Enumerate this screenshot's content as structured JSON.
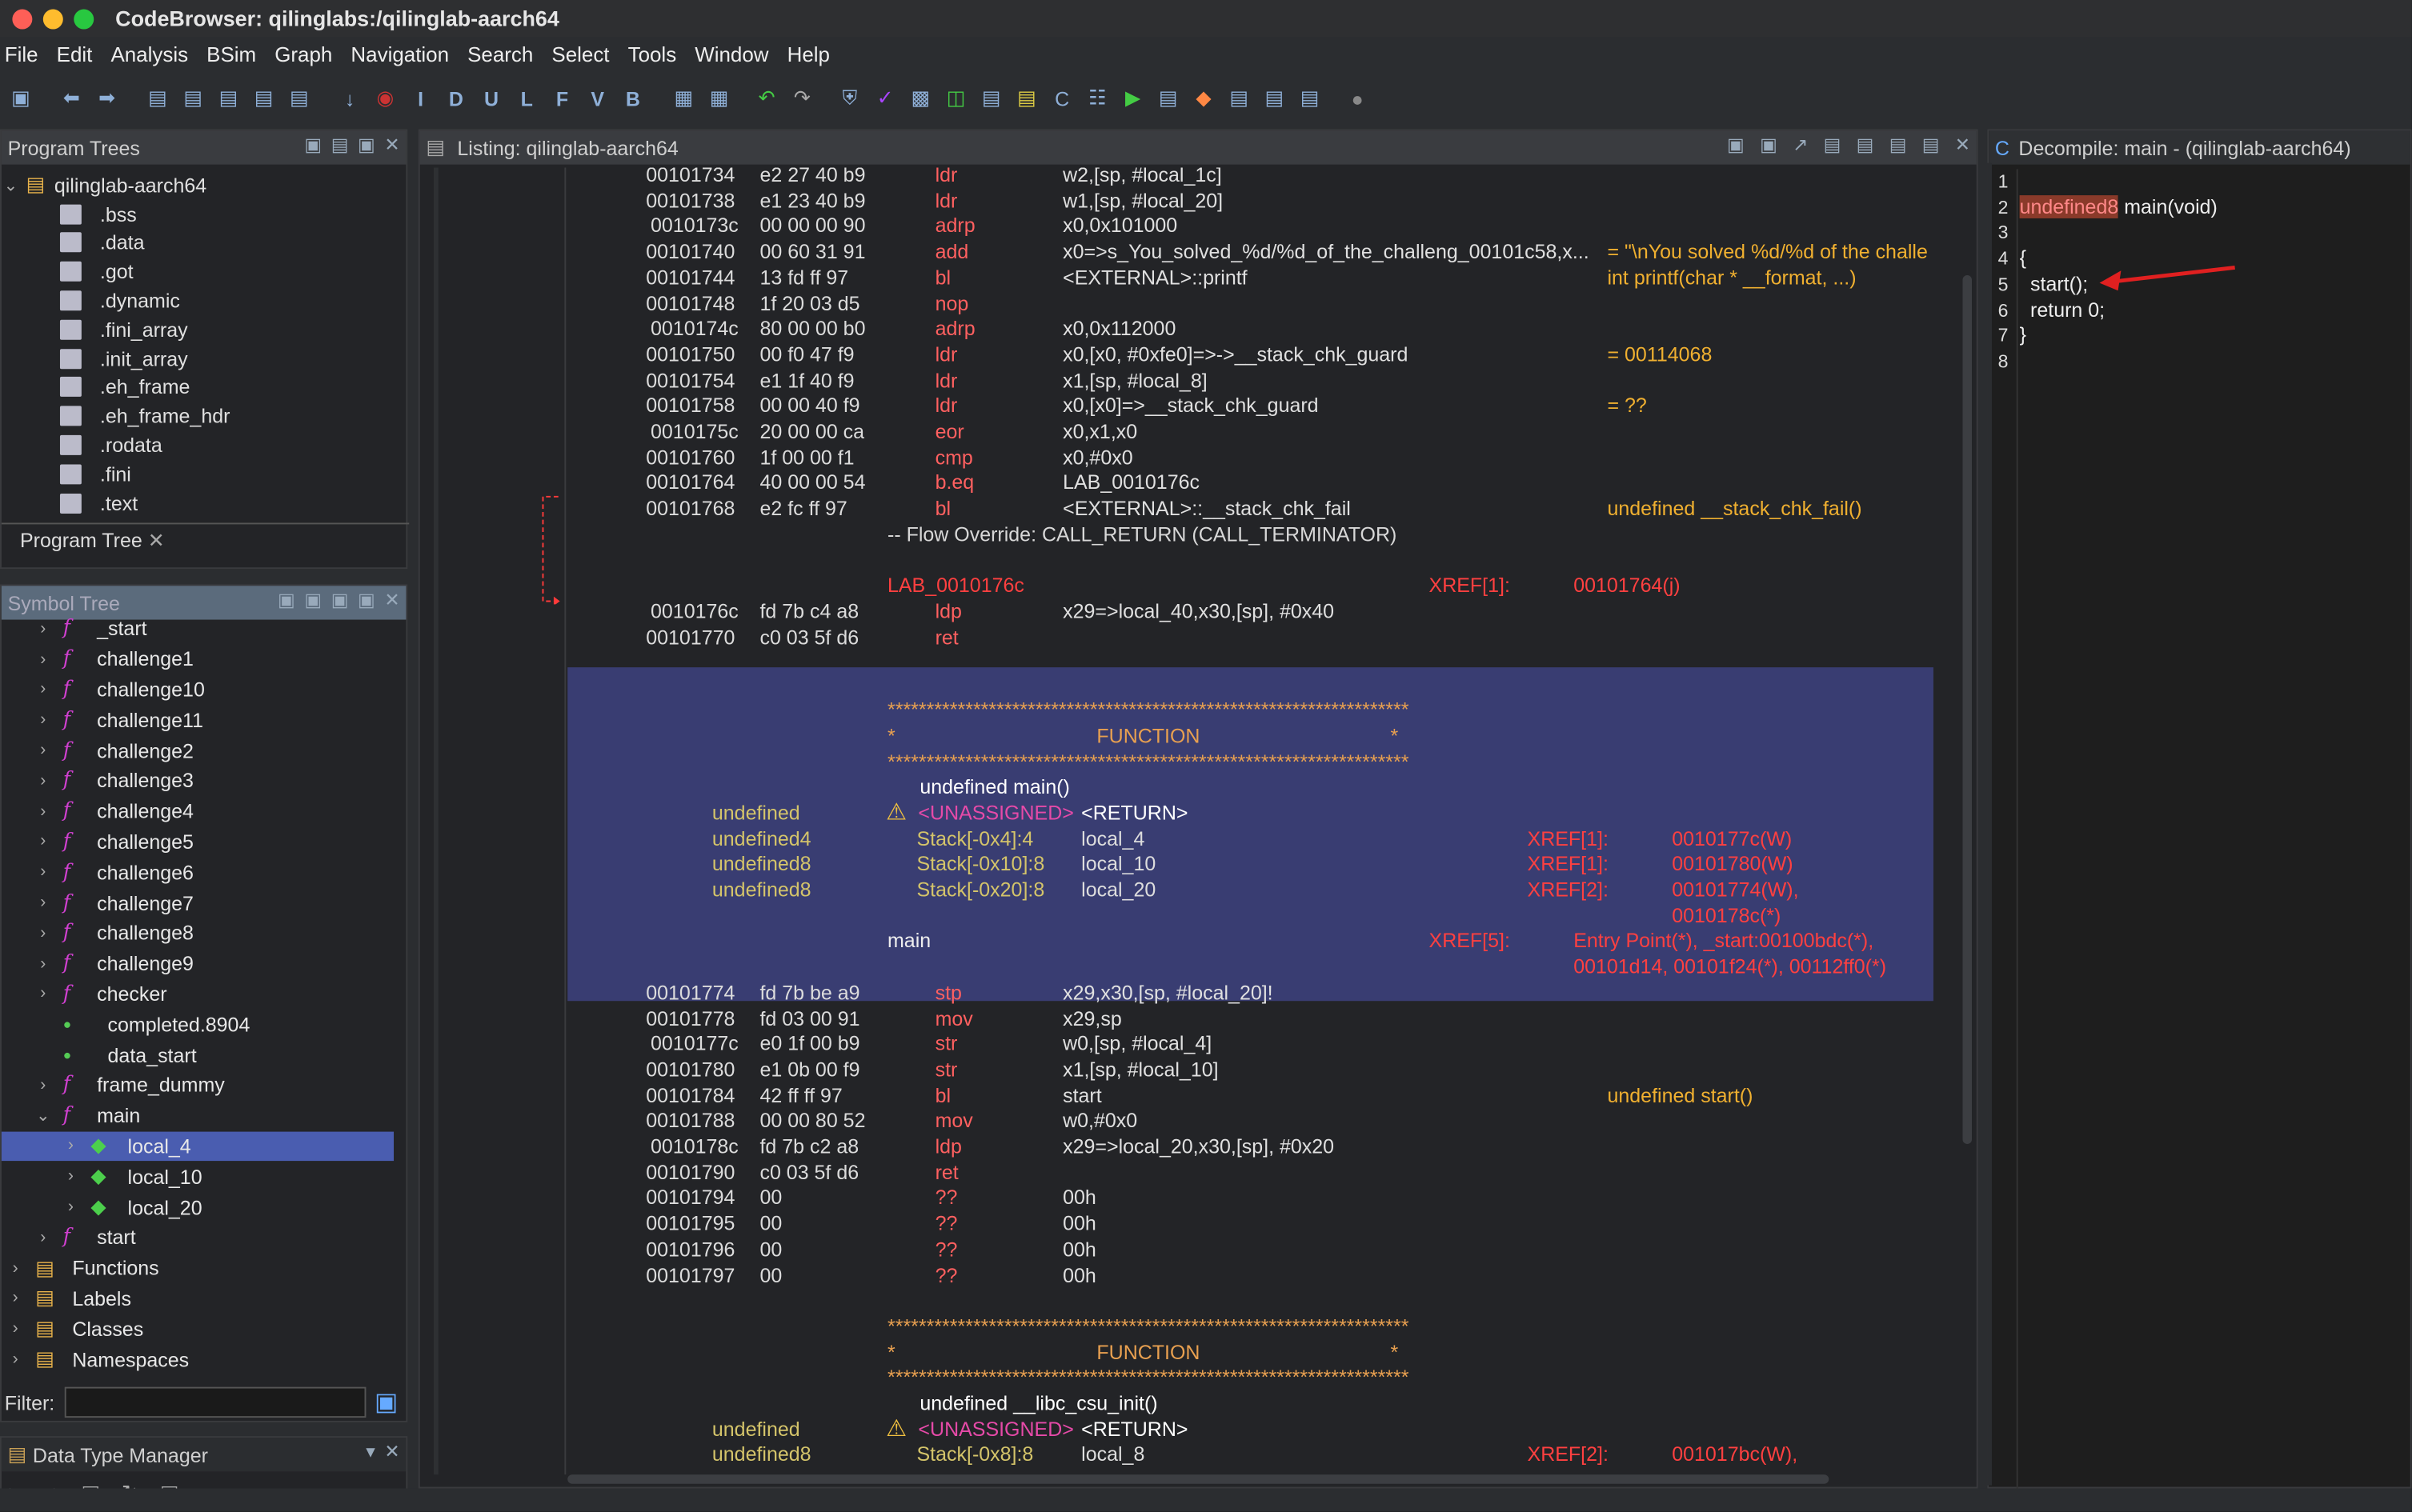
{
  "window": {
    "title": "CodeBrowser: qilinglabs:/qilinglab-aarch64"
  },
  "menu": [
    "File",
    "Edit",
    "Analysis",
    "BSim",
    "Graph",
    "Navigation",
    "Search",
    "Select",
    "Tools",
    "Window",
    "Help"
  ],
  "program_trees": {
    "title": "Program Trees",
    "root": "qilinglab-aarch64",
    "items": [
      ".bss",
      ".data",
      ".got",
      ".dynamic",
      ".fini_array",
      ".init_array",
      ".eh_frame",
      ".eh_frame_hdr",
      ".rodata",
      ".fini",
      ".text"
    ],
    "tab": "Program Tree"
  },
  "symbol_tree": {
    "title": "Symbol Tree",
    "items": [
      "_start",
      "challenge1",
      "challenge10",
      "challenge11",
      "challenge2",
      "challenge3",
      "challenge4",
      "challenge5",
      "challenge6",
      "challenge7",
      "challenge8",
      "challenge9",
      "checker",
      "completed.8904",
      "data_start",
      "frame_dummy",
      "main",
      "local_4",
      "local_10",
      "local_20",
      "start",
      "Functions",
      "Labels",
      "Classes",
      "Namespaces"
    ],
    "filter_label": "Filter:"
  },
  "dtm": {
    "title": "Data Type Manager"
  },
  "listing": {
    "title": "Listing:  qilinglab-aarch64",
    "rows": [
      {
        "a": "00101734",
        "b": "e2 27 40 b9",
        "m": "ldr",
        "o": "w2,[sp, #local_1c]"
      },
      {
        "a": "00101738",
        "b": "e1 23 40 b9",
        "m": "ldr",
        "o": "w1,[sp, #local_20]"
      },
      {
        "a": "0010173c",
        "b": "00 00 00 90",
        "m": "adrp",
        "o": "x0,0x101000"
      },
      {
        "a": "00101740",
        "b": "00 60 31 91",
        "m": "add",
        "o": "x0=>s_You_solved_%d/%d_of_the_challeng_00101c58,x...",
        "c": "= \"\\nYou solved %d/%d of the challe"
      },
      {
        "a": "00101744",
        "b": "13 fd ff 97",
        "m": "bl",
        "o": "<EXTERNAL>::printf",
        "c": "int printf(char * __format, ...)"
      },
      {
        "a": "00101748",
        "b": "1f 20 03 d5",
        "m": "nop",
        "o": ""
      },
      {
        "a": "0010174c",
        "b": "80 00 00 b0",
        "m": "adrp",
        "o": "x0,0x112000"
      },
      {
        "a": "00101750",
        "b": "00 f0 47 f9",
        "m": "ldr",
        "o": "x0,[x0, #0xfe0]=>->__stack_chk_guard",
        "c": "= 00114068"
      },
      {
        "a": "00101754",
        "b": "e1 1f 40 f9",
        "m": "ldr",
        "o": "x1,[sp, #local_8]"
      },
      {
        "a": "00101758",
        "b": "00 00 40 f9",
        "m": "ldr",
        "o": "x0,[x0]=>__stack_chk_guard",
        "c": "= ??"
      },
      {
        "a": "0010175c",
        "b": "20 00 00 ca",
        "m": "eor",
        "o": "x0,x1,x0"
      },
      {
        "a": "00101760",
        "b": "1f 00 00 f1",
        "m": "cmp",
        "o": "x0,#0x0"
      },
      {
        "a": "00101764",
        "b": "40 00 00 54",
        "m": "b.eq",
        "o": "LAB_0010176c"
      },
      {
        "a": "00101768",
        "b": "e2 fc ff 97",
        "m": "bl",
        "o": "<EXTERNAL>::__stack_chk_fail",
        "c": "undefined __stack_chk_fail()"
      }
    ],
    "flow_override": "-- Flow Override: CALL_RETURN (CALL_TERMINATOR)",
    "lab": "LAB_0010176c",
    "lab_xref_label": "XREF[1]:",
    "lab_xref": "00101764(j)",
    "rows2": [
      {
        "a": "0010176c",
        "b": "fd 7b c4 a8",
        "m": "ldp",
        "o": "x29=>local_40,x30,[sp], #0x40"
      },
      {
        "a": "00101770",
        "b": "c0 03 5f d6",
        "m": "ret",
        "o": ""
      }
    ],
    "stars": "*******************************************************************",
    "func_word": "FUNCTION",
    "main_sig": "undefined main()",
    "main_vars": [
      {
        "t": "undefined",
        "s": "<UNASSIGNED>",
        "n": "<RETURN>",
        "xl": "",
        "xv": ""
      },
      {
        "t": "undefined4",
        "s": "Stack[-0x4]:4",
        "n": "local_4",
        "xl": "XREF[1]:",
        "xv": "0010177c(W)"
      },
      {
        "t": "undefined8",
        "s": "Stack[-0x10]:8",
        "n": "local_10",
        "xl": "XREF[1]:",
        "xv": "00101780(W)"
      },
      {
        "t": "undefined8",
        "s": "Stack[-0x20]:8",
        "n": "local_20",
        "xl": "XREF[2]:",
        "xv": "00101774(W),"
      }
    ],
    "main_xref_cont": "0010178c(*)",
    "main_label": "main",
    "main_xref_label": "XREF[5]:",
    "main_xrefs1": "Entry Point(*), _start:00100bdc(*),",
    "main_xrefs2": "00101d14, 00101f24(*), 00112ff0(*)",
    "rows3": [
      {
        "a": "00101774",
        "b": "fd 7b be a9",
        "m": "stp",
        "o": "x29,x30,[sp, #local_20]!"
      },
      {
        "a": "00101778",
        "b": "fd 03 00 91",
        "m": "mov",
        "o": "x29,sp"
      },
      {
        "a": "0010177c",
        "b": "e0 1f 00 b9",
        "m": "str",
        "o": "w0,[sp, #local_4]"
      },
      {
        "a": "00101780",
        "b": "e1 0b 00 f9",
        "m": "str",
        "o": "x1,[sp, #local_10]"
      },
      {
        "a": "00101784",
        "b": "42 ff ff 97",
        "m": "bl",
        "o": "start",
        "c": "undefined start()"
      },
      {
        "a": "00101788",
        "b": "00 00 80 52",
        "m": "mov",
        "o": "w0,#0x0"
      },
      {
        "a": "0010178c",
        "b": "fd 7b c2 a8",
        "m": "ldp",
        "o": "x29=>local_20,x30,[sp], #0x20"
      },
      {
        "a": "00101790",
        "b": "c0 03 5f d6",
        "m": "ret",
        "o": ""
      },
      {
        "a": "00101794",
        "b": "00",
        "m": "??",
        "o": "00h"
      },
      {
        "a": "00101795",
        "b": "00",
        "m": "??",
        "o": "00h"
      },
      {
        "a": "00101796",
        "b": "00",
        "m": "??",
        "o": "00h"
      },
      {
        "a": "00101797",
        "b": "00",
        "m": "??",
        "o": "00h"
      }
    ],
    "libc_sig": "undefined __libc_csu_init()",
    "libc_vars": [
      {
        "t": "undefined",
        "s": "<UNASSIGNED>",
        "n": "<RETURN>",
        "xl": "",
        "xv": ""
      },
      {
        "t": "undefined8",
        "s": "Stack[-0x8]:8",
        "n": "local_8",
        "xl": "XREF[2]:",
        "xv": "001017bc(W),"
      }
    ]
  },
  "decompile": {
    "title": "Decompile: main -  (qilinglab-aarch64)",
    "line_numbers": [
      "1",
      "2",
      "3",
      "4",
      "5",
      "6",
      "7",
      "8"
    ],
    "ret_type": "undefined8",
    "sig_rest": " main(void)",
    "open": "{",
    "l5": "start();",
    "l6": "return 0;",
    "close": "}"
  }
}
